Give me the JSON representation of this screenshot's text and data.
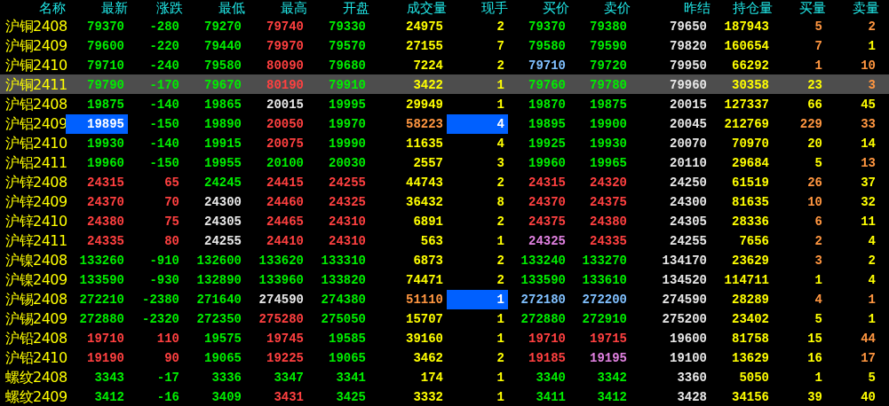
{
  "columns": [
    "名称",
    "最新",
    "涨跌",
    "最低",
    "最高",
    "开盘",
    "成交量",
    "现手",
    "买价",
    "卖价",
    "昨结",
    "持仓量",
    "买量",
    "卖量"
  ],
  "rows": [
    {
      "name": "沪铜2408",
      "selected": false,
      "cells": [
        {
          "text": "79370",
          "color": "#00ee00",
          "highlighted": false
        },
        {
          "text": "-280",
          "color": "#00ee00",
          "highlighted": false
        },
        {
          "text": "79270",
          "color": "#00ee00",
          "highlighted": false
        },
        {
          "text": "79740",
          "color": "#ff4040",
          "highlighted": false
        },
        {
          "text": "79330",
          "color": "#00ee00",
          "highlighted": false
        },
        {
          "text": "24975",
          "color": "#ffff00",
          "highlighted": false
        },
        {
          "text": "2",
          "color": "#ffff00",
          "highlighted": false
        },
        {
          "text": "79370",
          "color": "#00ee00",
          "highlighted": false
        },
        {
          "text": "79380",
          "color": "#00ee00",
          "highlighted": false
        },
        {
          "text": "79650",
          "color": "#e8e8e8",
          "highlighted": false
        },
        {
          "text": "187943",
          "color": "#ffff00",
          "highlighted": false
        },
        {
          "text": "5",
          "color": "#ff9640",
          "highlighted": false
        },
        {
          "text": "2",
          "color": "#ff9640",
          "highlighted": false
        }
      ]
    },
    {
      "name": "沪铜2409",
      "selected": false,
      "cells": [
        {
          "text": "79600",
          "color": "#00ee00",
          "highlighted": false
        },
        {
          "text": "-220",
          "color": "#00ee00",
          "highlighted": false
        },
        {
          "text": "79440",
          "color": "#00ee00",
          "highlighted": false
        },
        {
          "text": "79970",
          "color": "#ff4040",
          "highlighted": false
        },
        {
          "text": "79570",
          "color": "#00ee00",
          "highlighted": false
        },
        {
          "text": "27155",
          "color": "#ffff00",
          "highlighted": false
        },
        {
          "text": "7",
          "color": "#ffff00",
          "highlighted": false
        },
        {
          "text": "79580",
          "color": "#00ee00",
          "highlighted": false
        },
        {
          "text": "79590",
          "color": "#00ee00",
          "highlighted": false
        },
        {
          "text": "79820",
          "color": "#e8e8e8",
          "highlighted": false
        },
        {
          "text": "160654",
          "color": "#ffff00",
          "highlighted": false
        },
        {
          "text": "7",
          "color": "#ff9640",
          "highlighted": false
        },
        {
          "text": "1",
          "color": "#ffff00",
          "highlighted": false
        }
      ]
    },
    {
      "name": "沪铜2410",
      "selected": false,
      "cells": [
        {
          "text": "79710",
          "color": "#00ee00",
          "highlighted": false
        },
        {
          "text": "-240",
          "color": "#00ee00",
          "highlighted": false
        },
        {
          "text": "79580",
          "color": "#00ee00",
          "highlighted": false
        },
        {
          "text": "80090",
          "color": "#ff4040",
          "highlighted": false
        },
        {
          "text": "79680",
          "color": "#00ee00",
          "highlighted": false
        },
        {
          "text": "7224",
          "color": "#ffff00",
          "highlighted": false
        },
        {
          "text": "2",
          "color": "#ffff00",
          "highlighted": false
        },
        {
          "text": "79710",
          "color": "#80c0ff",
          "highlighted": false
        },
        {
          "text": "79720",
          "color": "#00ee00",
          "highlighted": false
        },
        {
          "text": "79950",
          "color": "#e8e8e8",
          "highlighted": false
        },
        {
          "text": "66292",
          "color": "#ffff00",
          "highlighted": false
        },
        {
          "text": "1",
          "color": "#ff9640",
          "highlighted": false
        },
        {
          "text": "10",
          "color": "#ff9640",
          "highlighted": false
        }
      ]
    },
    {
      "name": "沪铜2411",
      "selected": true,
      "cells": [
        {
          "text": "79790",
          "color": "#00ee00",
          "highlighted": false
        },
        {
          "text": "-170",
          "color": "#00ee00",
          "highlighted": false
        },
        {
          "text": "79670",
          "color": "#00ee00",
          "highlighted": false
        },
        {
          "text": "80190",
          "color": "#ff4040",
          "highlighted": false
        },
        {
          "text": "79910",
          "color": "#00ee00",
          "highlighted": false
        },
        {
          "text": "3422",
          "color": "#ffff00",
          "highlighted": false
        },
        {
          "text": "1",
          "color": "#ffff00",
          "highlighted": false
        },
        {
          "text": "79760",
          "color": "#00ee00",
          "highlighted": false
        },
        {
          "text": "79780",
          "color": "#00ee00",
          "highlighted": false
        },
        {
          "text": "79960",
          "color": "#e8e8e8",
          "highlighted": false
        },
        {
          "text": "30358",
          "color": "#ffff00",
          "highlighted": false
        },
        {
          "text": "23",
          "color": "#ffff00",
          "highlighted": false
        },
        {
          "text": "3",
          "color": "#ff9640",
          "highlighted": false
        }
      ]
    },
    {
      "name": "沪铝2408",
      "selected": false,
      "cells": [
        {
          "text": "19875",
          "color": "#00ee00",
          "highlighted": false
        },
        {
          "text": "-140",
          "color": "#00ee00",
          "highlighted": false
        },
        {
          "text": "19865",
          "color": "#00ee00",
          "highlighted": false
        },
        {
          "text": "20015",
          "color": "#e8e8e8",
          "highlighted": false
        },
        {
          "text": "19995",
          "color": "#00ee00",
          "highlighted": false
        },
        {
          "text": "29949",
          "color": "#ffff00",
          "highlighted": false
        },
        {
          "text": "1",
          "color": "#ffff00",
          "highlighted": false
        },
        {
          "text": "19870",
          "color": "#00ee00",
          "highlighted": false
        },
        {
          "text": "19875",
          "color": "#00ee00",
          "highlighted": false
        },
        {
          "text": "20015",
          "color": "#e8e8e8",
          "highlighted": false
        },
        {
          "text": "127337",
          "color": "#ffff00",
          "highlighted": false
        },
        {
          "text": "66",
          "color": "#ffff00",
          "highlighted": false
        },
        {
          "text": "45",
          "color": "#ffff00",
          "highlighted": false
        }
      ]
    },
    {
      "name": "沪铝2409",
      "selected": false,
      "cells": [
        {
          "text": "19895",
          "color": "#ffffff",
          "highlighted": true
        },
        {
          "text": "-150",
          "color": "#00ee00",
          "highlighted": false
        },
        {
          "text": "19890",
          "color": "#00ee00",
          "highlighted": false
        },
        {
          "text": "20050",
          "color": "#ff4040",
          "highlighted": false
        },
        {
          "text": "19970",
          "color": "#00ee00",
          "highlighted": false
        },
        {
          "text": "58223",
          "color": "#ff9640",
          "highlighted": false
        },
        {
          "text": "4",
          "color": "#ffffff",
          "highlighted": true
        },
        {
          "text": "19895",
          "color": "#00ee00",
          "highlighted": false
        },
        {
          "text": "19900",
          "color": "#00ee00",
          "highlighted": false
        },
        {
          "text": "20045",
          "color": "#e8e8e8",
          "highlighted": false
        },
        {
          "text": "212769",
          "color": "#ffff00",
          "highlighted": false
        },
        {
          "text": "229",
          "color": "#ff9640",
          "highlighted": false
        },
        {
          "text": "33",
          "color": "#ff9640",
          "highlighted": false
        }
      ]
    },
    {
      "name": "沪铝2410",
      "selected": false,
      "cells": [
        {
          "text": "19930",
          "color": "#00ee00",
          "highlighted": false
        },
        {
          "text": "-140",
          "color": "#00ee00",
          "highlighted": false
        },
        {
          "text": "19915",
          "color": "#00ee00",
          "highlighted": false
        },
        {
          "text": "20075",
          "color": "#ff4040",
          "highlighted": false
        },
        {
          "text": "19990",
          "color": "#00ee00",
          "highlighted": false
        },
        {
          "text": "11635",
          "color": "#ffff00",
          "highlighted": false
        },
        {
          "text": "4",
          "color": "#ffff00",
          "highlighted": false
        },
        {
          "text": "19925",
          "color": "#00ee00",
          "highlighted": false
        },
        {
          "text": "19930",
          "color": "#00ee00",
          "highlighted": false
        },
        {
          "text": "20070",
          "color": "#e8e8e8",
          "highlighted": false
        },
        {
          "text": "70970",
          "color": "#ffff00",
          "highlighted": false
        },
        {
          "text": "20",
          "color": "#ffff00",
          "highlighted": false
        },
        {
          "text": "14",
          "color": "#ffff00",
          "highlighted": false
        }
      ]
    },
    {
      "name": "沪铝2411",
      "selected": false,
      "cells": [
        {
          "text": "19960",
          "color": "#00ee00",
          "highlighted": false
        },
        {
          "text": "-150",
          "color": "#00ee00",
          "highlighted": false
        },
        {
          "text": "19955",
          "color": "#00ee00",
          "highlighted": false
        },
        {
          "text": "20100",
          "color": "#00ee00",
          "highlighted": false
        },
        {
          "text": "20030",
          "color": "#00ee00",
          "highlighted": false
        },
        {
          "text": "2557",
          "color": "#ffff00",
          "highlighted": false
        },
        {
          "text": "3",
          "color": "#ffff00",
          "highlighted": false
        },
        {
          "text": "19960",
          "color": "#00ee00",
          "highlighted": false
        },
        {
          "text": "19965",
          "color": "#00ee00",
          "highlighted": false
        },
        {
          "text": "20110",
          "color": "#e8e8e8",
          "highlighted": false
        },
        {
          "text": "29684",
          "color": "#ffff00",
          "highlighted": false
        },
        {
          "text": "5",
          "color": "#ffff00",
          "highlighted": false
        },
        {
          "text": "13",
          "color": "#ff9640",
          "highlighted": false
        }
      ]
    },
    {
      "name": "沪锌2408",
      "selected": false,
      "cells": [
        {
          "text": "24315",
          "color": "#ff4040",
          "highlighted": false
        },
        {
          "text": "65",
          "color": "#ff4040",
          "highlighted": false
        },
        {
          "text": "24245",
          "color": "#00ee00",
          "highlighted": false
        },
        {
          "text": "24415",
          "color": "#ff4040",
          "highlighted": false
        },
        {
          "text": "24255",
          "color": "#ff4040",
          "highlighted": false
        },
        {
          "text": "44743",
          "color": "#ffff00",
          "highlighted": false
        },
        {
          "text": "2",
          "color": "#ffff00",
          "highlighted": false
        },
        {
          "text": "24315",
          "color": "#ff4040",
          "highlighted": false
        },
        {
          "text": "24320",
          "color": "#ff4040",
          "highlighted": false
        },
        {
          "text": "24250",
          "color": "#e8e8e8",
          "highlighted": false
        },
        {
          "text": "61519",
          "color": "#ffff00",
          "highlighted": false
        },
        {
          "text": "26",
          "color": "#ff9640",
          "highlighted": false
        },
        {
          "text": "37",
          "color": "#ffff00",
          "highlighted": false
        }
      ]
    },
    {
      "name": "沪锌2409",
      "selected": false,
      "cells": [
        {
          "text": "24370",
          "color": "#ff4040",
          "highlighted": false
        },
        {
          "text": "70",
          "color": "#ff4040",
          "highlighted": false
        },
        {
          "text": "24300",
          "color": "#e8e8e8",
          "highlighted": false
        },
        {
          "text": "24460",
          "color": "#ff4040",
          "highlighted": false
        },
        {
          "text": "24325",
          "color": "#ff4040",
          "highlighted": false
        },
        {
          "text": "36432",
          "color": "#ffff00",
          "highlighted": false
        },
        {
          "text": "8",
          "color": "#ffff00",
          "highlighted": false
        },
        {
          "text": "24370",
          "color": "#ff4040",
          "highlighted": false
        },
        {
          "text": "24375",
          "color": "#ff4040",
          "highlighted": false
        },
        {
          "text": "24300",
          "color": "#e8e8e8",
          "highlighted": false
        },
        {
          "text": "81635",
          "color": "#ffff00",
          "highlighted": false
        },
        {
          "text": "10",
          "color": "#ff9640",
          "highlighted": false
        },
        {
          "text": "32",
          "color": "#ffff00",
          "highlighted": false
        }
      ]
    },
    {
      "name": "沪锌2410",
      "selected": false,
      "cells": [
        {
          "text": "24380",
          "color": "#ff4040",
          "highlighted": false
        },
        {
          "text": "75",
          "color": "#ff4040",
          "highlighted": false
        },
        {
          "text": "24305",
          "color": "#e8e8e8",
          "highlighted": false
        },
        {
          "text": "24465",
          "color": "#ff4040",
          "highlighted": false
        },
        {
          "text": "24310",
          "color": "#ff4040",
          "highlighted": false
        },
        {
          "text": "6891",
          "color": "#ffff00",
          "highlighted": false
        },
        {
          "text": "2",
          "color": "#ffff00",
          "highlighted": false
        },
        {
          "text": "24375",
          "color": "#ff4040",
          "highlighted": false
        },
        {
          "text": "24380",
          "color": "#ff4040",
          "highlighted": false
        },
        {
          "text": "24305",
          "color": "#e8e8e8",
          "highlighted": false
        },
        {
          "text": "28336",
          "color": "#ffff00",
          "highlighted": false
        },
        {
          "text": "6",
          "color": "#ff9640",
          "highlighted": false
        },
        {
          "text": "11",
          "color": "#ffff00",
          "highlighted": false
        }
      ]
    },
    {
      "name": "沪锌2411",
      "selected": false,
      "cells": [
        {
          "text": "24335",
          "color": "#ff4040",
          "highlighted": false
        },
        {
          "text": "80",
          "color": "#ff4040",
          "highlighted": false
        },
        {
          "text": "24255",
          "color": "#e8e8e8",
          "highlighted": false
        },
        {
          "text": "24410",
          "color": "#ff4040",
          "highlighted": false
        },
        {
          "text": "24310",
          "color": "#ff4040",
          "highlighted": false
        },
        {
          "text": "563",
          "color": "#ffff00",
          "highlighted": false
        },
        {
          "text": "1",
          "color": "#ffff00",
          "highlighted": false
        },
        {
          "text": "24325",
          "color": "#e080e0",
          "highlighted": false
        },
        {
          "text": "24335",
          "color": "#ff4040",
          "highlighted": false
        },
        {
          "text": "24255",
          "color": "#e8e8e8",
          "highlighted": false
        },
        {
          "text": "7656",
          "color": "#ffff00",
          "highlighted": false
        },
        {
          "text": "2",
          "color": "#ff9640",
          "highlighted": false
        },
        {
          "text": "4",
          "color": "#ffff00",
          "highlighted": false
        }
      ]
    },
    {
      "name": "沪镍2408",
      "selected": false,
      "cells": [
        {
          "text": "133260",
          "color": "#00ee00",
          "highlighted": false
        },
        {
          "text": "-910",
          "color": "#00ee00",
          "highlighted": false
        },
        {
          "text": "132600",
          "color": "#00ee00",
          "highlighted": false
        },
        {
          "text": "133620",
          "color": "#00ee00",
          "highlighted": false
        },
        {
          "text": "133310",
          "color": "#00ee00",
          "highlighted": false
        },
        {
          "text": "6873",
          "color": "#ffff00",
          "highlighted": false
        },
        {
          "text": "2",
          "color": "#ffff00",
          "highlighted": false
        },
        {
          "text": "133240",
          "color": "#00ee00",
          "highlighted": false
        },
        {
          "text": "133270",
          "color": "#00ee00",
          "highlighted": false
        },
        {
          "text": "134170",
          "color": "#e8e8e8",
          "highlighted": false
        },
        {
          "text": "23629",
          "color": "#ffff00",
          "highlighted": false
        },
        {
          "text": "3",
          "color": "#ff9640",
          "highlighted": false
        },
        {
          "text": "2",
          "color": "#ffff00",
          "highlighted": false
        }
      ]
    },
    {
      "name": "沪镍2409",
      "selected": false,
      "cells": [
        {
          "text": "133590",
          "color": "#00ee00",
          "highlighted": false
        },
        {
          "text": "-930",
          "color": "#00ee00",
          "highlighted": false
        },
        {
          "text": "132890",
          "color": "#00ee00",
          "highlighted": false
        },
        {
          "text": "133960",
          "color": "#00ee00",
          "highlighted": false
        },
        {
          "text": "133820",
          "color": "#00ee00",
          "highlighted": false
        },
        {
          "text": "74471",
          "color": "#ffff00",
          "highlighted": false
        },
        {
          "text": "2",
          "color": "#ffff00",
          "highlighted": false
        },
        {
          "text": "133590",
          "color": "#00ee00",
          "highlighted": false
        },
        {
          "text": "133610",
          "color": "#00ee00",
          "highlighted": false
        },
        {
          "text": "134520",
          "color": "#e8e8e8",
          "highlighted": false
        },
        {
          "text": "114711",
          "color": "#ffff00",
          "highlighted": false
        },
        {
          "text": "1",
          "color": "#ffff00",
          "highlighted": false
        },
        {
          "text": "4",
          "color": "#ffff00",
          "highlighted": false
        }
      ]
    },
    {
      "name": "沪锡2408",
      "selected": false,
      "cells": [
        {
          "text": "272210",
          "color": "#00ee00",
          "highlighted": false
        },
        {
          "text": "-2380",
          "color": "#00ee00",
          "highlighted": false
        },
        {
          "text": "271640",
          "color": "#00ee00",
          "highlighted": false
        },
        {
          "text": "274590",
          "color": "#e8e8e8",
          "highlighted": false
        },
        {
          "text": "274380",
          "color": "#00ee00",
          "highlighted": false
        },
        {
          "text": "51110",
          "color": "#ff9640",
          "highlighted": false
        },
        {
          "text": "1",
          "color": "#ffffff",
          "highlighted": true
        },
        {
          "text": "272180",
          "color": "#80c0ff",
          "highlighted": false
        },
        {
          "text": "272200",
          "color": "#80c0ff",
          "highlighted": false
        },
        {
          "text": "274590",
          "color": "#e8e8e8",
          "highlighted": false
        },
        {
          "text": "28289",
          "color": "#ffff00",
          "highlighted": false
        },
        {
          "text": "4",
          "color": "#ff9640",
          "highlighted": false
        },
        {
          "text": "1",
          "color": "#ff9640",
          "highlighted": false
        }
      ]
    },
    {
      "name": "沪锡2409",
      "selected": false,
      "cells": [
        {
          "text": "272880",
          "color": "#00ee00",
          "highlighted": false
        },
        {
          "text": "-2320",
          "color": "#00ee00",
          "highlighted": false
        },
        {
          "text": "272350",
          "color": "#00ee00",
          "highlighted": false
        },
        {
          "text": "275280",
          "color": "#ff4040",
          "highlighted": false
        },
        {
          "text": "275050",
          "color": "#00ee00",
          "highlighted": false
        },
        {
          "text": "15707",
          "color": "#ffff00",
          "highlighted": false
        },
        {
          "text": "1",
          "color": "#ffff00",
          "highlighted": false
        },
        {
          "text": "272880",
          "color": "#00ee00",
          "highlighted": false
        },
        {
          "text": "272910",
          "color": "#00ee00",
          "highlighted": false
        },
        {
          "text": "275200",
          "color": "#e8e8e8",
          "highlighted": false
        },
        {
          "text": "23402",
          "color": "#ffff00",
          "highlighted": false
        },
        {
          "text": "5",
          "color": "#ffff00",
          "highlighted": false
        },
        {
          "text": "1",
          "color": "#ffff00",
          "highlighted": false
        }
      ]
    },
    {
      "name": "沪铅2408",
      "selected": false,
      "cells": [
        {
          "text": "19710",
          "color": "#ff4040",
          "highlighted": false
        },
        {
          "text": "110",
          "color": "#ff4040",
          "highlighted": false
        },
        {
          "text": "19575",
          "color": "#00ee00",
          "highlighted": false
        },
        {
          "text": "19745",
          "color": "#ff4040",
          "highlighted": false
        },
        {
          "text": "19585",
          "color": "#00ee00",
          "highlighted": false
        },
        {
          "text": "39160",
          "color": "#ffff00",
          "highlighted": false
        },
        {
          "text": "1",
          "color": "#ffff00",
          "highlighted": false
        },
        {
          "text": "19710",
          "color": "#ff4040",
          "highlighted": false
        },
        {
          "text": "19715",
          "color": "#ff4040",
          "highlighted": false
        },
        {
          "text": "19600",
          "color": "#e8e8e8",
          "highlighted": false
        },
        {
          "text": "81758",
          "color": "#ffff00",
          "highlighted": false
        },
        {
          "text": "15",
          "color": "#ffff00",
          "highlighted": false
        },
        {
          "text": "44",
          "color": "#ff9640",
          "highlighted": false
        }
      ]
    },
    {
      "name": "沪铅2410",
      "selected": false,
      "cells": [
        {
          "text": "19190",
          "color": "#ff4040",
          "highlighted": false
        },
        {
          "text": "90",
          "color": "#ff4040",
          "highlighted": false
        },
        {
          "text": "19065",
          "color": "#00ee00",
          "highlighted": false
        },
        {
          "text": "19225",
          "color": "#ff4040",
          "highlighted": false
        },
        {
          "text": "19065",
          "color": "#00ee00",
          "highlighted": false
        },
        {
          "text": "3462",
          "color": "#ffff00",
          "highlighted": false
        },
        {
          "text": "2",
          "color": "#ffff00",
          "highlighted": false
        },
        {
          "text": "19185",
          "color": "#ff4040",
          "highlighted": false
        },
        {
          "text": "19195",
          "color": "#e080e0",
          "highlighted": false
        },
        {
          "text": "19100",
          "color": "#e8e8e8",
          "highlighted": false
        },
        {
          "text": "13629",
          "color": "#ffff00",
          "highlighted": false
        },
        {
          "text": "16",
          "color": "#ffff00",
          "highlighted": false
        },
        {
          "text": "17",
          "color": "#ff9640",
          "highlighted": false
        }
      ]
    },
    {
      "name": "螺纹2408",
      "selected": false,
      "cells": [
        {
          "text": "3343",
          "color": "#00ee00",
          "highlighted": false
        },
        {
          "text": "-17",
          "color": "#00ee00",
          "highlighted": false
        },
        {
          "text": "3336",
          "color": "#00ee00",
          "highlighted": false
        },
        {
          "text": "3347",
          "color": "#00ee00",
          "highlighted": false
        },
        {
          "text": "3341",
          "color": "#00ee00",
          "highlighted": false
        },
        {
          "text": "174",
          "color": "#ffff00",
          "highlighted": false
        },
        {
          "text": "1",
          "color": "#ffff00",
          "highlighted": false
        },
        {
          "text": "3340",
          "color": "#00ee00",
          "highlighted": false
        },
        {
          "text": "3342",
          "color": "#00ee00",
          "highlighted": false
        },
        {
          "text": "3360",
          "color": "#e8e8e8",
          "highlighted": false
        },
        {
          "text": "5050",
          "color": "#ffff00",
          "highlighted": false
        },
        {
          "text": "1",
          "color": "#ffff00",
          "highlighted": false
        },
        {
          "text": "5",
          "color": "#ffff00",
          "highlighted": false
        }
      ]
    },
    {
      "name": "螺纹2409",
      "selected": false,
      "cells": [
        {
          "text": "3412",
          "color": "#00ee00",
          "highlighted": false
        },
        {
          "text": "-16",
          "color": "#00ee00",
          "highlighted": false
        },
        {
          "text": "3409",
          "color": "#00ee00",
          "highlighted": false
        },
        {
          "text": "3431",
          "color": "#ff4040",
          "highlighted": false
        },
        {
          "text": "3425",
          "color": "#00ee00",
          "highlighted": false
        },
        {
          "text": "3332",
          "color": "#ffff00",
          "highlighted": false
        },
        {
          "text": "1",
          "color": "#ffff00",
          "highlighted": false
        },
        {
          "text": "3411",
          "color": "#00ee00",
          "highlighted": false
        },
        {
          "text": "3412",
          "color": "#00ee00",
          "highlighted": false
        },
        {
          "text": "3428",
          "color": "#e8e8e8",
          "highlighted": false
        },
        {
          "text": "34156",
          "color": "#ffff00",
          "highlighted": false
        },
        {
          "text": "39",
          "color": "#ffff00",
          "highlighted": false
        },
        {
          "text": "40",
          "color": "#ffff00",
          "highlighted": false
        }
      ]
    }
  ]
}
